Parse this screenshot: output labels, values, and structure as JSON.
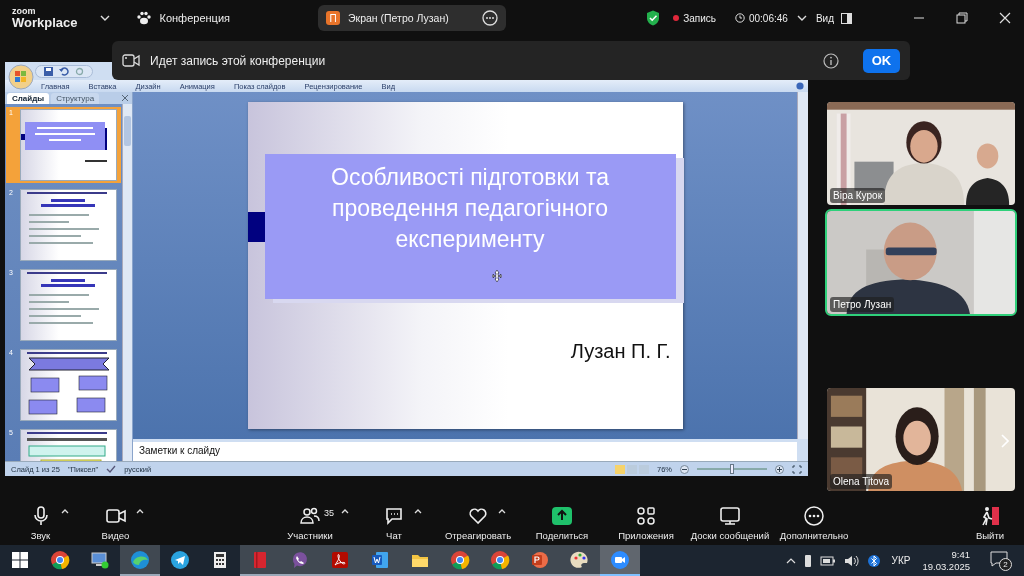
{
  "topbar": {
    "logo_small": "zoom",
    "logo_large": "Workplace",
    "meeting": "Конференция",
    "share_initial": "П",
    "share_title": "Экран (Петро Лузан)",
    "recording": "Запись",
    "timer": "00:06:46",
    "view": "Вид"
  },
  "banner": {
    "text": "Идет запись этой конференции",
    "button": "OK"
  },
  "powerpoint": {
    "ribbon_tabs": [
      "Главная",
      "Вставка",
      "Дизайн",
      "Анимация",
      "Показ слайдов",
      "Рецензирование",
      "Вид"
    ],
    "panel_tabs": [
      {
        "label": "Слайды",
        "selected": true
      },
      {
        "label": "Структура",
        "selected": false
      }
    ],
    "thumbnails": [
      {
        "number": "1",
        "selected": true,
        "kind": "title"
      },
      {
        "number": "2",
        "selected": false,
        "kind": "list"
      },
      {
        "number": "3",
        "selected": false,
        "kind": "list"
      },
      {
        "number": "4",
        "selected": false,
        "kind": "diagram"
      },
      {
        "number": "5",
        "selected": false,
        "kind": "boxes"
      }
    ],
    "slide": {
      "title": "Особливості підготовки та проведення педагогічного експерименту",
      "author": "Лузан П. Г."
    },
    "notes_placeholder": "Заметки к слайду",
    "status_bar": {
      "slide_counter": "Слайд 1 из 25",
      "theme": "\"Пиксел\"",
      "language": "русский",
      "zoom": "76%",
      "level": 0.5
    }
  },
  "participants": [
    {
      "name": "Віра Курок",
      "active_speaker": false
    },
    {
      "name": "Петро Лузан",
      "active_speaker": true
    },
    {
      "name": "Olena Titova",
      "active_speaker": false
    }
  ],
  "toolbar": {
    "left": [
      {
        "kind": "mic",
        "label": "Звук",
        "caret": true
      },
      {
        "kind": "video",
        "label": "Видео",
        "caret": true
      }
    ],
    "center": [
      {
        "kind": "people",
        "label": "Участники",
        "count": "35",
        "caret": true
      },
      {
        "kind": "chat",
        "label": "Чат",
        "caret": true
      },
      {
        "kind": "heart",
        "label": "Отреагировать",
        "caret": true
      },
      {
        "kind": "share",
        "label": "Поделиться",
        "caret": false
      },
      {
        "kind": "apps",
        "label": "Приложения",
        "caret": false
      },
      {
        "kind": "board",
        "label": "Доски сообщений",
        "caret": false
      },
      {
        "kind": "more",
        "label": "Дополнительно",
        "caret": false
      }
    ],
    "right": [
      {
        "kind": "leave",
        "label": "Выйти",
        "caret": false
      }
    ]
  },
  "taskbar": {
    "apps": [
      {
        "kind": "start",
        "open": false,
        "active": false
      },
      {
        "kind": "chrome",
        "open": false,
        "active": false
      },
      {
        "kind": "computer",
        "open": false,
        "active": false
      },
      {
        "kind": "edge",
        "open": true,
        "active": false
      },
      {
        "kind": "telegram",
        "open": false,
        "active": false
      },
      {
        "kind": "calculator",
        "open": false,
        "active": false
      },
      {
        "kind": "book",
        "open": true,
        "active": false
      },
      {
        "kind": "viber",
        "open": true,
        "active": false
      },
      {
        "kind": "pdf",
        "open": true,
        "active": false
      },
      {
        "kind": "word",
        "open": true,
        "active": false
      },
      {
        "kind": "folder",
        "open": true,
        "active": false
      },
      {
        "kind": "chrome",
        "open": true,
        "active": false
      },
      {
        "kind": "chrome",
        "open": true,
        "active": false
      },
      {
        "kind": "powerpoint",
        "open": true,
        "active": false
      },
      {
        "kind": "paint",
        "open": true,
        "active": false
      },
      {
        "kind": "zoom",
        "open": true,
        "active": true
      }
    ],
    "language": "УКР",
    "time": "9:41",
    "date": "19.03.2025",
    "notifications": "2"
  }
}
